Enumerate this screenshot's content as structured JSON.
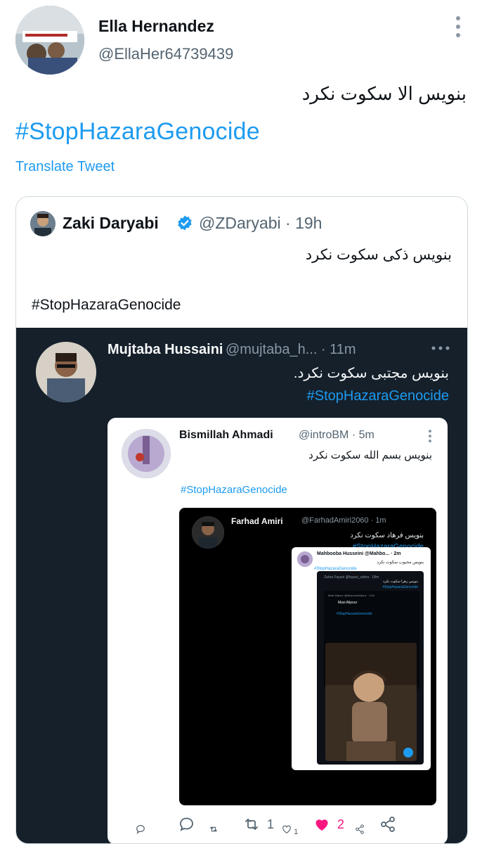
{
  "tweet": {
    "author_name": "Ella Hernandez",
    "author_handle": "@EllaHer64739439",
    "text": "بنویس الا سکوت نکرد",
    "hashtag": "#StopHazaraGenocide",
    "translate": "Translate Tweet"
  },
  "quote": {
    "author_name": "Zaki Daryabi",
    "author_handle": "@ZDaryabi · 19h",
    "text": "بنویس ذکی سکوت نکرد",
    "hashtag": "#StopHazaraGenocide"
  },
  "shot": {
    "name": "Mujtaba Hussaini",
    "handle": "@mujtaba_h... · 11m",
    "dots": "···",
    "text": "بنویس مجتبی سکوت نکرد.",
    "hashtag": "#StopHazaraGenocide"
  },
  "level2": {
    "name": "Bismillah Ahmadi",
    "handle": "@introBM · 5m",
    "text": "بنویس بسم الله سکوت نکرد",
    "hashtag": "#StopHazaraGenocide",
    "actions": {
      "retweets": "",
      "likes": "1"
    }
  },
  "level3": {
    "name": "Farhad Amiri",
    "handle": "@FarhadAmiri2060 · 1m",
    "text": "بنویس فرهاد سکوت نکرد",
    "hashtag": "#StopHazaraGenocide"
  },
  "level3b": {
    "name": "Mahbooba Husseini @Mahbo... · 2m",
    "text": "بنویس محبوب سکوت نکرد",
    "hashtag": "#StopHazaraGenocide"
  },
  "level4": {
    "name": "Zahra Fayazi @fayazi_zahra · 18m",
    "text": "بنویس زهرا سکوت نکرد",
    "hashtag": "#StopHazaraGenocide"
  },
  "level5": {
    "label": "Masi Alipour @MasomeAlipour · 22m",
    "name": "Masi Alipour",
    "hashtag": "#StopHazaraGenocide"
  },
  "actions": {
    "reply_count": "",
    "retweet_count": "1",
    "like_count": "2"
  },
  "colors": {
    "accent": "#1d9bf0",
    "like": "#f91880",
    "dark_bg": "#15202b"
  }
}
